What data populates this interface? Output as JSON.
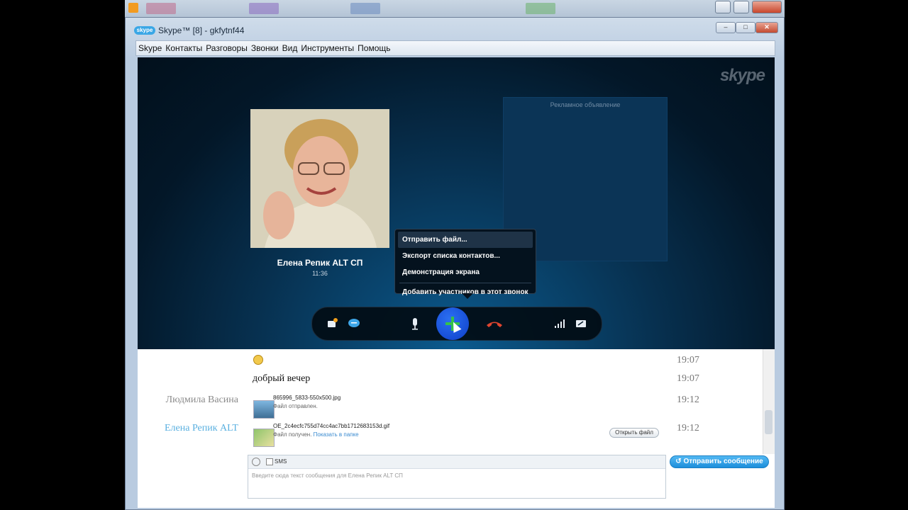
{
  "window": {
    "title": "Skype™ [8] - gkfytnf44"
  },
  "menu": [
    "Skype",
    "Контакты",
    "Разговоры",
    "Звонки",
    "Вид",
    "Инструменты",
    "Помощь"
  ],
  "call": {
    "watermark": "skype",
    "contact_name": "Елена Репик ALT СП",
    "duration": "11:36",
    "ad_label": "Рекламное объявление",
    "popup_items": [
      "Отправить файл...",
      "Экспорт списка контактов...",
      "Демонстрация экрана",
      "Добавить участников в этот звонок"
    ]
  },
  "chat": {
    "messages": [
      {
        "sender": "",
        "text": "",
        "time": "19:07",
        "emoticon": "smile-glasses-icon"
      },
      {
        "sender": "",
        "text": "добрый вечер",
        "time": "19:07"
      },
      {
        "sender": "Людмила Васина",
        "file": "865996_5833-550x500.jpg",
        "status": "Файл отправлен.",
        "time": "19:12"
      },
      {
        "sender": "Елена Репик ALT",
        "file": "OE_2c4ecfc755d74cc4ac7bb1712683153d.gif",
        "status": "Файл получен.",
        "status_link": "Показать в папке",
        "open_button": "Открыть файл",
        "time": "19:12"
      }
    ]
  },
  "input": {
    "sms_label": "SMS",
    "placeholder": "Введите сюда текст сообщения для Елена Репик ALT СП",
    "send_label": "Отправить сообщение"
  },
  "colors": {
    "stage_bg": "#031728",
    "accent_blue": "#1c8edb",
    "hangup_red": "#e0452f",
    "sender_blue": "#5ab0e0"
  }
}
